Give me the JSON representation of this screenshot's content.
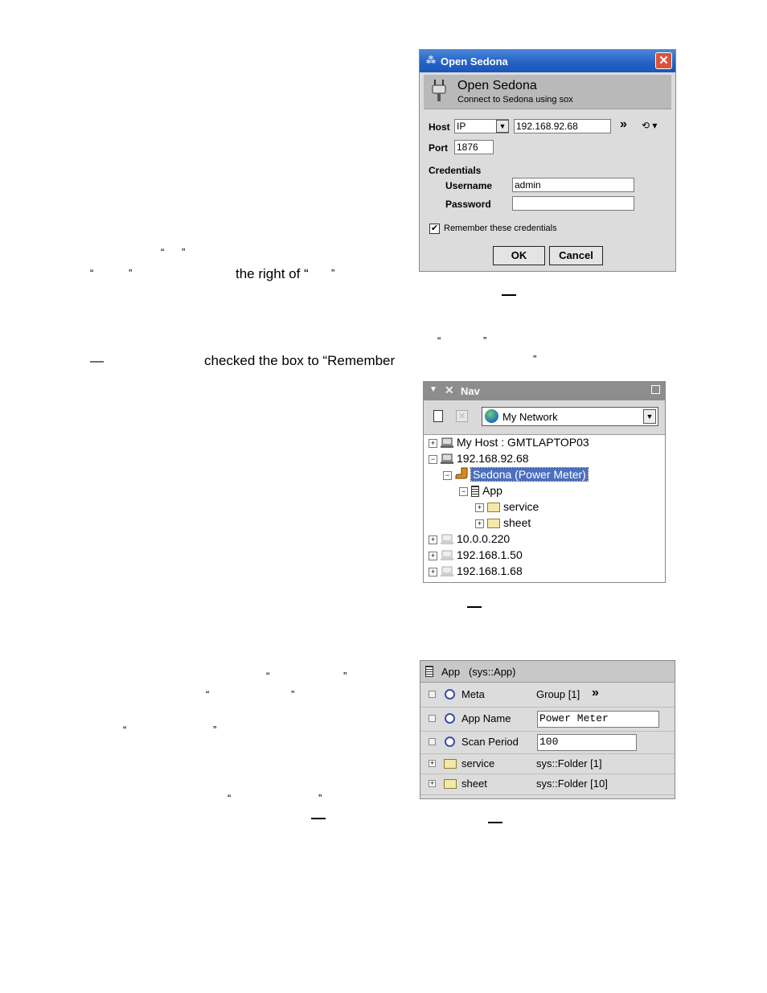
{
  "text": {
    "q1a": "“",
    "q1b": "”",
    "q2a": "“",
    "q2b": "”",
    "right_of": "the right of “",
    "q2c": "”",
    "q3a": "“",
    "q3b": "”",
    "dash1": "—",
    "checked": "checked the box to “Remember",
    "q3c": "”",
    "q4a": "“",
    "q4b": "”",
    "q5a": "“",
    "q5b": "”",
    "q6a": "“",
    "q6b": "”",
    "q7a": "“",
    "q7b": "”"
  },
  "dialog": {
    "title": "Open Sedona",
    "close_glyph": "✕",
    "header_title": "Open Sedona",
    "header_subtitle": "Connect to Sedona using sox",
    "host_label": "Host",
    "host_type": "IP",
    "host_value": "192.168.92.68",
    "more_glyph": "»",
    "history_glyph": "⟲ ▾",
    "port_label": "Port",
    "port_value": "1876",
    "credentials_label": "Credentials",
    "username_label": "Username",
    "username_value": "admin",
    "password_label": "Password",
    "password_value": "",
    "remember_label": "Remember these credentials",
    "remember_checked": true,
    "ok_label": "OK",
    "cancel_label": "Cancel"
  },
  "nav": {
    "title": "Nav",
    "network": "My Network",
    "tree": [
      {
        "label": "My Host : GMTLAPTOP03",
        "expander": "+",
        "icon": "host-icon"
      },
      {
        "label": "192.168.92.68",
        "expander": "−",
        "icon": "host-icon"
      },
      {
        "label": "Sedona (Power Meter)",
        "expander": "−",
        "icon": "sedona-icon",
        "selected": true
      },
      {
        "label": "App",
        "expander": "−",
        "icon": "app-icon"
      },
      {
        "label": "service",
        "expander": "+",
        "icon": "folder-icon"
      },
      {
        "label": "sheet",
        "expander": "+",
        "icon": "folder-icon"
      },
      {
        "label": "10.0.0.220",
        "expander": "+",
        "icon": "host-icon"
      },
      {
        "label": "192.168.1.50",
        "expander": "+",
        "icon": "host-icon"
      },
      {
        "label": "192.168.1.68",
        "expander": "+",
        "icon": "host-icon"
      }
    ]
  },
  "props": {
    "title": "App   (sys::App)",
    "rows": [
      {
        "name": "Meta",
        "value": "Group [1]",
        "extra": "»"
      },
      {
        "name": "App Name",
        "value": "Power Meter"
      },
      {
        "name": "Scan Period",
        "value": "100"
      },
      {
        "name": "service",
        "value": "sys::Folder [1]"
      },
      {
        "name": "sheet",
        "value": "sys::Folder [10]"
      }
    ]
  }
}
